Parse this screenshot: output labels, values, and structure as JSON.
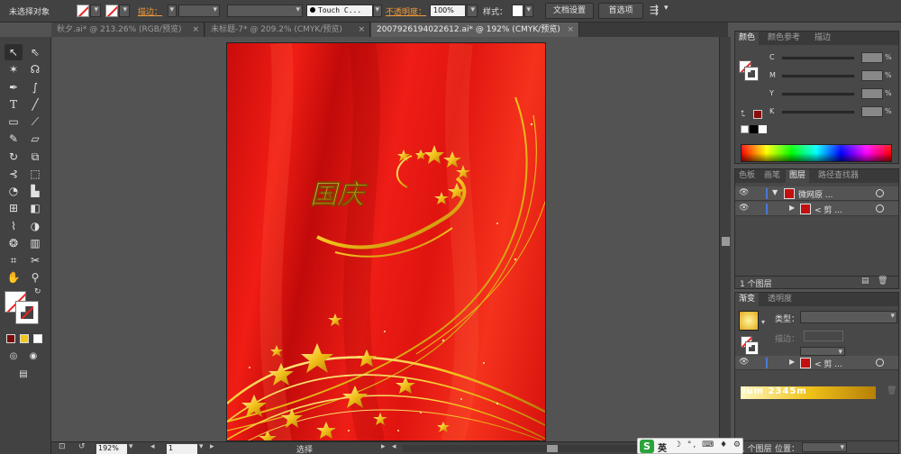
{
  "control_bar": {
    "selection_status": "未选择对象",
    "stroke_label": "描边：",
    "brush_name": "Touch C...",
    "opacity_label": "不透明度：",
    "opacity_value": "100%",
    "style_label": "样式：",
    "doc_setup_button": "文档设置",
    "preferences_button": "首选项"
  },
  "doc_tabs": [
    {
      "label": "秋夕.ai* @ 213.26% (RGB/预览)",
      "active": false
    },
    {
      "label": "未标题-7* @ 209.2% (CMYK/预览)",
      "active": false
    },
    {
      "label": "2007926194022612.ai* @ 192% (CMYK/预览)",
      "active": true
    }
  ],
  "artwork": {
    "title_glyph_text": "国庆",
    "colors": {
      "red": "#e5140f",
      "gold": "#f5c518"
    }
  },
  "status_bar": {
    "zoom": "192%",
    "page": "1",
    "status_text": "选择"
  },
  "color_panel": {
    "tabs": [
      "颜色",
      "颜色参考",
      "描边"
    ],
    "channels": [
      "C",
      "M",
      "Y",
      "K"
    ],
    "percent_sign": "%"
  },
  "layers_panel": {
    "tabs": [
      "色板",
      "画笔",
      "图层",
      "路径查找器"
    ],
    "rows": [
      {
        "name": "微网原 ..."
      },
      {
        "name": "< 剪 ..."
      }
    ],
    "footer": "1 个图层"
  },
  "gradient_panel": {
    "tabs": [
      "渐变",
      "透明度"
    ],
    "type_label": "类型：",
    "stroke_label": "描边：",
    "row_name": "< 剪 ...",
    "watermark": "ium 2345m",
    "footer": "1 个图层",
    "position_label": "位置："
  },
  "ime": {
    "logo": "S",
    "mode": "英",
    "rest": "☽ °, ⌨ ♦ ⚙"
  }
}
